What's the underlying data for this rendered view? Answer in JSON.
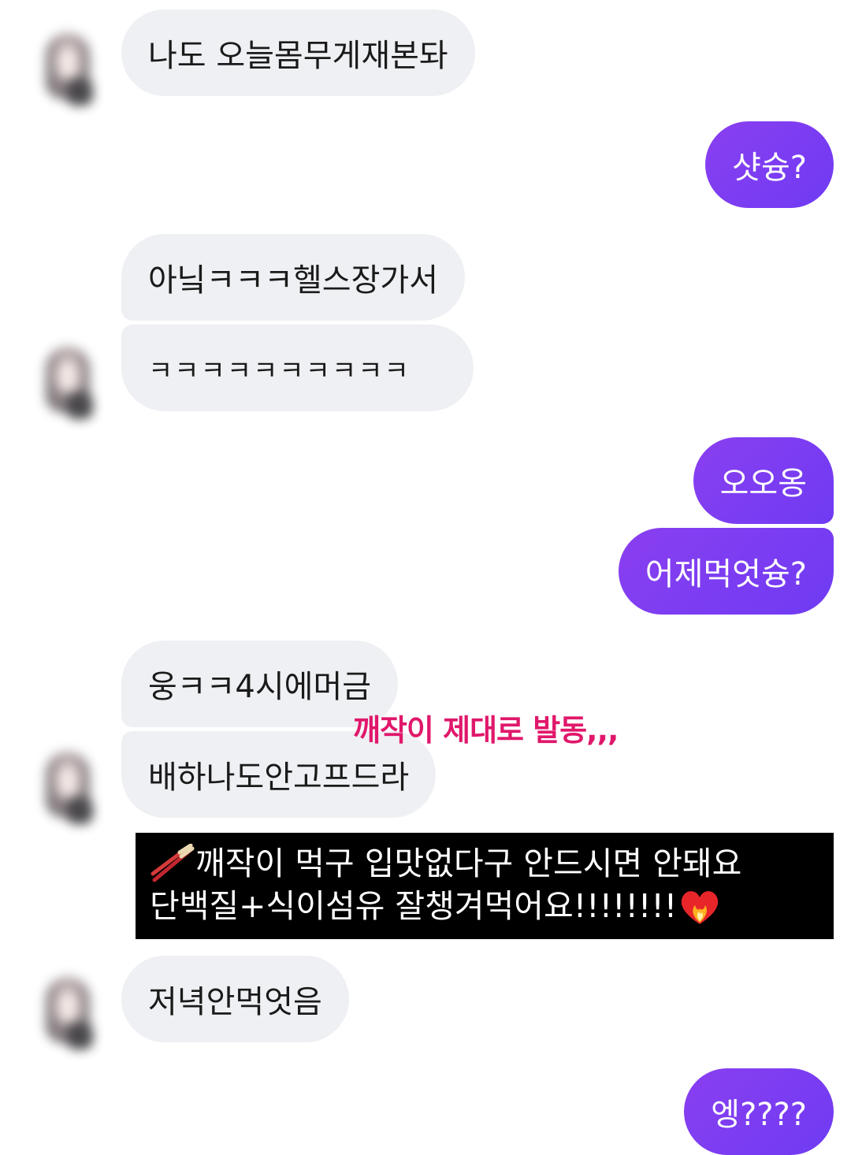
{
  "messages": {
    "m1": "나도 오늘몸무게재본돠",
    "m2": "샷슝?",
    "m3": "아닠ㅋㅋㅋ헬스장가서",
    "m4": "ㅋㅋㅋㅋㅋㅋㅋㅋㅋㅋ",
    "m5": "오오옹",
    "m6": "어제먹엇슝?",
    "m7": "웅ㅋㅋ4시에머금",
    "m8": "배하나도안고프드라",
    "m9": "저녁안먹엇음",
    "m10": "엥????"
  },
  "annotation": "깨작이 제대로 발동,,,",
  "caption": {
    "line1": "깨작이  먹구  입맛없다구  안드시면  안돼요",
    "line2": "단백질+식이섬유  잘챙겨먹어요!!!!!!!!",
    "icon_start": "chopsticks-icon",
    "icon_end": "heart-on-fire-icon"
  },
  "colors": {
    "sent_bubble": "#7a3df2",
    "received_bubble": "#eff0f3",
    "annotation": "#e0186b",
    "caption_bg": "#000000"
  }
}
